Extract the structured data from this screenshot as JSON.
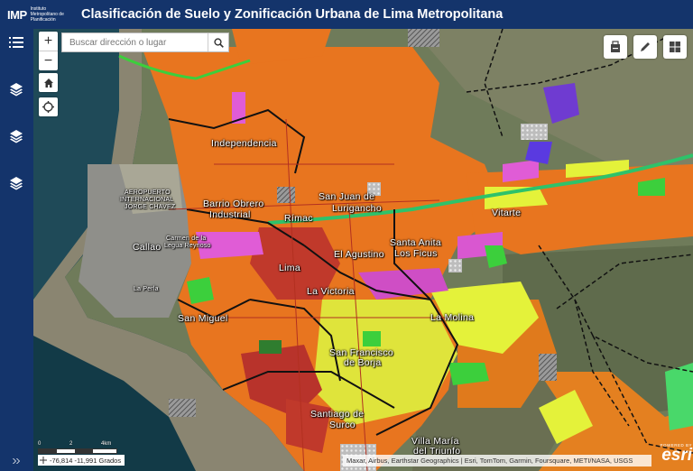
{
  "header": {
    "logo_mark": "IMP",
    "logo_text": "Instituto Metropolitano de Planificación",
    "title": "Clasificación de Suelo y Zonificación Urbana de Lima Metropolitana"
  },
  "sidebar": {
    "items": [
      {
        "name": "list-icon"
      },
      {
        "name": "layers-icon"
      },
      {
        "name": "layers-icon"
      },
      {
        "name": "layers-icon"
      }
    ],
    "expand_icon": "double-chevron-right-icon"
  },
  "search": {
    "placeholder": "Buscar dirección o lugar"
  },
  "zoom": {
    "in": "+",
    "out": "−"
  },
  "map_labels": [
    {
      "text": "Independencia"
    },
    {
      "text": "San Juan de"
    },
    {
      "text": "Lurigancho"
    },
    {
      "text": "Barrio Obrero"
    },
    {
      "text": "Industrial"
    },
    {
      "text": "Rímac"
    },
    {
      "text": "Vitarte"
    },
    {
      "text": "Carmen de la"
    },
    {
      "text": "Legua Reynoso"
    },
    {
      "text": "Callao"
    },
    {
      "text": "El Agustino"
    },
    {
      "text": "Santa Anita"
    },
    {
      "text": "Los Ficus"
    },
    {
      "text": "Lima"
    },
    {
      "text": "La Perla"
    },
    {
      "text": "La Victoria"
    },
    {
      "text": "San Miguel"
    },
    {
      "text": "La Molina"
    },
    {
      "text": "San Francisco"
    },
    {
      "text": "de Borja"
    },
    {
      "text": "Santiago de"
    },
    {
      "text": "Surco"
    },
    {
      "text": "Villa María"
    },
    {
      "text": "del Triunfo"
    },
    {
      "text": "AEROPUERTO"
    },
    {
      "text": "INTERNACIONAL"
    },
    {
      "text": "JORGE CHAVEZ"
    }
  ],
  "scale": {
    "l0": "0",
    "l1": "2",
    "l2": "4km"
  },
  "coords": {
    "text": "-76,814 -11,991 Grados"
  },
  "attribution": {
    "text": "Maxar, Airbus, Earthstar Geographics | Esri, TomTom, Garmin, Foursquare, METI/NASA, USGS"
  },
  "esri": {
    "powered": "POWERED BY",
    "word": "esri"
  },
  "colors": {
    "header": "#14346b",
    "residential": "#e8751f",
    "commercial": "#c0392b",
    "industrial": "#e05cd6",
    "green": "#3ccf3c",
    "yellow": "#e4f23a"
  }
}
